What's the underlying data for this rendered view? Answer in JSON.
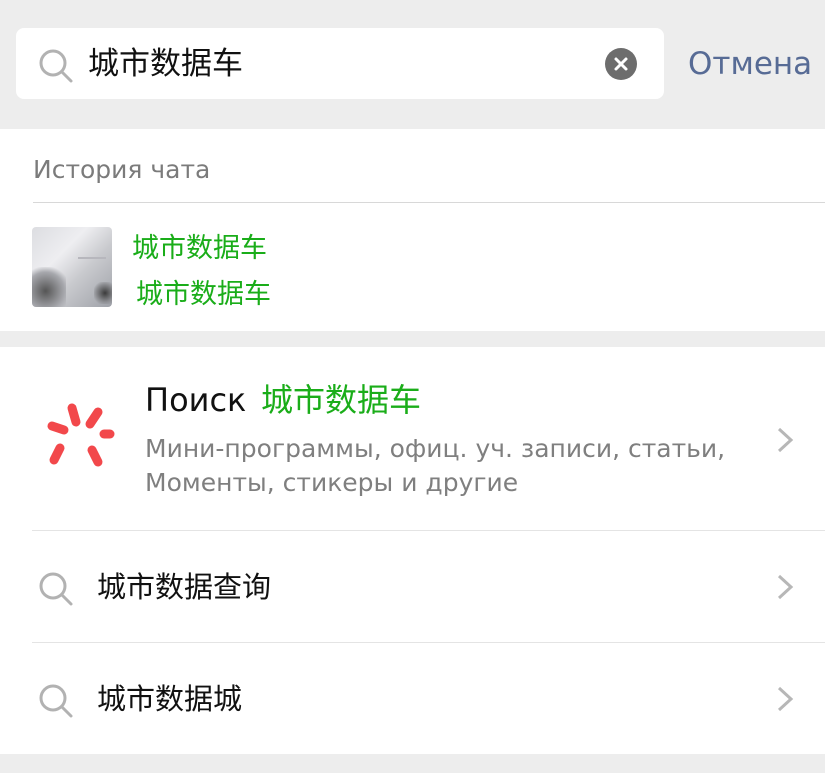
{
  "search": {
    "query": "城市数据车",
    "cancel_label": "Отмена"
  },
  "history": {
    "title": "История чата",
    "item": {
      "line1": "城市数据车",
      "line2": "城市数据车"
    }
  },
  "primary_result": {
    "label": "Поиск",
    "term": "城市数据车",
    "description": "Мини-программы, офиц. уч. записи, статьи, Моменты, стикеры и другие"
  },
  "suggestions": [
    {
      "text": "城市数据查询"
    },
    {
      "text": "城市数据城"
    }
  ],
  "colors": {
    "highlight": "#1aad19",
    "link": "#576b95",
    "logo": "#f2484b"
  },
  "icons": [
    "search-icon",
    "clear-icon",
    "search-logo-icon",
    "chevron-right-icon"
  ]
}
